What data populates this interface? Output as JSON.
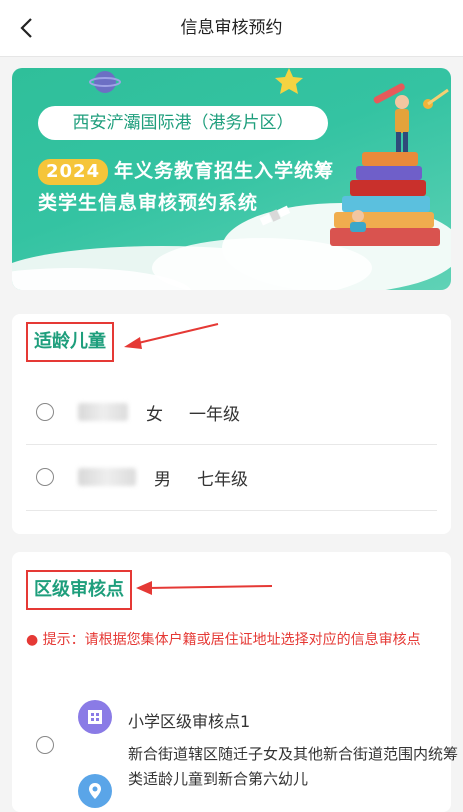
{
  "nav": {
    "title": "信息审核预约",
    "back_icon": "chevron-left-icon"
  },
  "banner": {
    "pill": "西安浐灞国际港（港务片区）",
    "year": "2024",
    "line1_rest": "年义务教育招生入学统筹",
    "line2": "类学生信息审核预约系统"
  },
  "children": {
    "title": "适龄儿童",
    "items": [
      {
        "gender": "女",
        "grade": "一年级"
      },
      {
        "gender": "男",
        "grade": "七年级"
      }
    ]
  },
  "district": {
    "title": "区级审核点",
    "tip": "提示：请根据您集体户籍或居住证地址选择对应的信息审核点",
    "site": {
      "name": "小学区级审核点1",
      "desc": "新合街道辖区随迁子女及其他新合街道范围内统筹类适龄儿童到新合第六幼儿"
    }
  },
  "colors": {
    "accent": "#1e9e7c",
    "banner": "#34c3a2",
    "highlight": "#e53935",
    "site_icon": "#8a7be6"
  }
}
